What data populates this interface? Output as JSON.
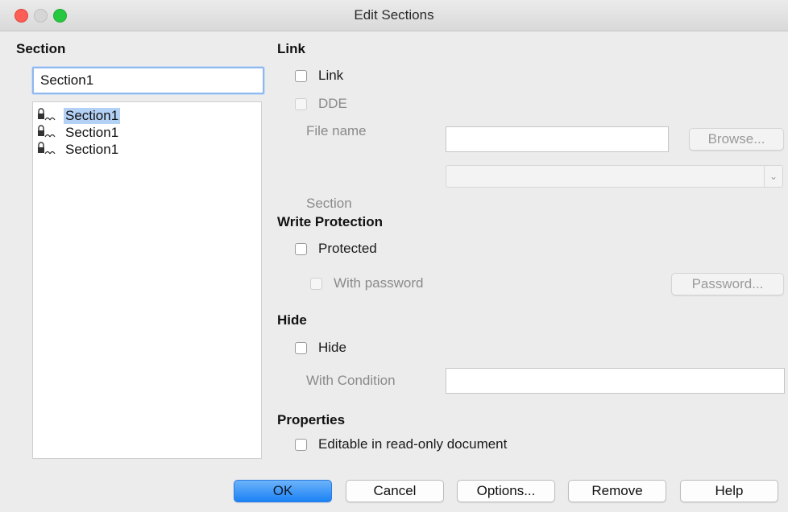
{
  "window": {
    "title": "Edit Sections"
  },
  "section_panel": {
    "heading": "Section",
    "name_value": "Section1",
    "list": [
      {
        "label": "Section1",
        "icon": "lock-icon",
        "selected": true
      },
      {
        "label": "Section1",
        "icon": "lock-icon",
        "selected": false
      },
      {
        "label": "Section1",
        "icon": "lock-icon",
        "selected": false
      }
    ]
  },
  "link": {
    "heading": "Link",
    "link_label": "Link",
    "dde_label": "DDE",
    "file_name_label": "File name",
    "file_name_value": "",
    "browse_label": "Browse...",
    "section_label": "Section",
    "section_value": ""
  },
  "write_protection": {
    "heading": "Write Protection",
    "protected_label": "Protected",
    "with_password_label": "With password",
    "password_button": "Password..."
  },
  "hide": {
    "heading": "Hide",
    "hide_label": "Hide",
    "with_condition_label": "With Condition",
    "condition_value": ""
  },
  "properties": {
    "heading": "Properties",
    "editable_label": "Editable in read-only document"
  },
  "buttons": {
    "ok": "OK",
    "cancel": "Cancel",
    "options": "Options...",
    "remove": "Remove",
    "help": "Help"
  },
  "colors": {
    "accent": "#1b82f5",
    "selection": "#b3d1f5",
    "close": "#fd5f57",
    "maximize": "#27c840"
  }
}
